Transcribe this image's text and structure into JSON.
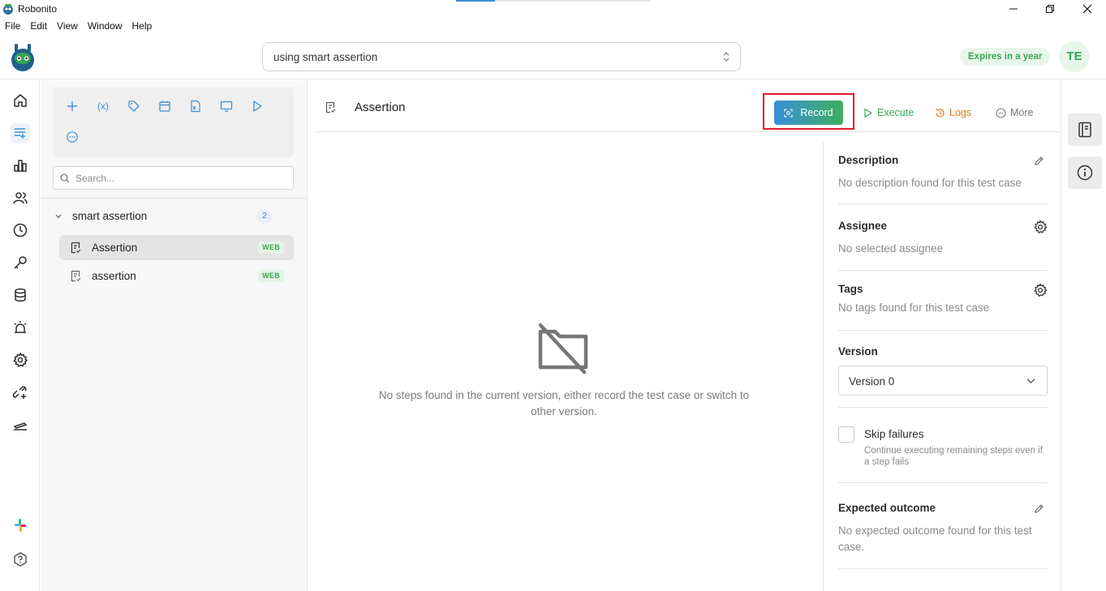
{
  "window": {
    "title": "Robonito",
    "minimize_glyph": "minimize-icon",
    "restore_glyph": "restore-icon",
    "close_glyph": "close-icon"
  },
  "menu": [
    "File",
    "Edit",
    "View",
    "Window",
    "Help"
  ],
  "header": {
    "project_value": "using smart assertion",
    "expires_label": "Expires in a year",
    "avatar_initials": "TE"
  },
  "sidebar_rail": {
    "icons": [
      "home-icon",
      "test-cases-icon",
      "reports-icon",
      "users-icon",
      "history-icon",
      "keys-icon",
      "database-icon",
      "alerts-icon",
      "settings-icon",
      "integrations-icon",
      "schedule-icon"
    ],
    "active": "test-cases-icon",
    "bottom_icons": [
      "slack-icon",
      "help-icon"
    ]
  },
  "toolbar": {
    "tools": [
      "add-icon",
      "variable-icon",
      "tag-icon",
      "calendar-icon",
      "excel-icon",
      "monitor-icon",
      "play-icon",
      "more-circle-icon"
    ],
    "variable_glyph": "(x)"
  },
  "tc_search": {
    "placeholder": "Search..."
  },
  "suite": {
    "name": "smart assertion",
    "count": "2",
    "items": [
      {
        "name": "Assertion",
        "badge": "WEB",
        "selected": true
      },
      {
        "name": "assertion",
        "badge": "WEB",
        "selected": false
      }
    ]
  },
  "main": {
    "title": "Assertion",
    "actions": {
      "record": "Record",
      "execute": "Execute",
      "logs": "Logs",
      "more": "More"
    },
    "empty_message": "No steps found in the current version, either record the test case or switch to other version."
  },
  "details": {
    "description": {
      "label": "Description",
      "value": "No description found for this test case"
    },
    "assignee": {
      "label": "Assignee",
      "value": "No selected assignee"
    },
    "tags": {
      "label": "Tags",
      "value": "No tags found for this test case"
    },
    "version": {
      "label": "Version",
      "value": "Version 0"
    },
    "skip_failures": {
      "label": "Skip failures",
      "hint": "Continue executing remaining steps even if a step fails",
      "checked": false
    },
    "expected_outcome": {
      "label": "Expected outcome",
      "value": "No expected outcome found for this test case."
    }
  },
  "right_rail": [
    "notebook-icon",
    "info-icon"
  ],
  "colors": {
    "accent_blue": "#3f8ed6",
    "accent_green": "#3aa655",
    "logs_orange": "#e07b1a",
    "highlight_red": "#e01c2f"
  }
}
